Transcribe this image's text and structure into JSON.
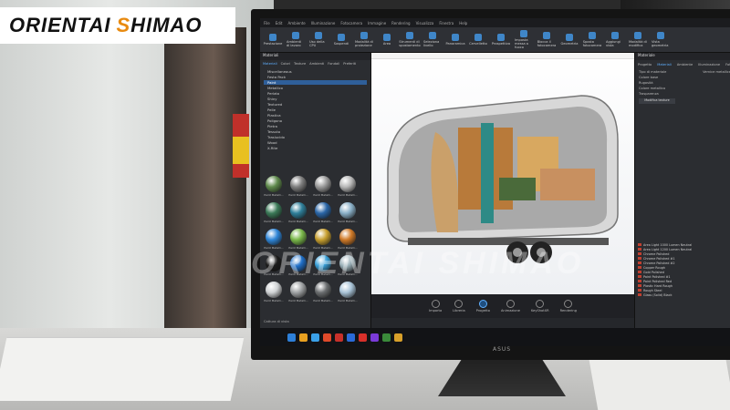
{
  "watermark": {
    "part1": "ORIENTAI",
    "part2_accent": "S",
    "part2_rest": "HIMAO",
    "overlay": "ORIENTAI SHIMAO",
    "accent_color": "#e88a10"
  },
  "app": {
    "menu": [
      "File",
      "Edit",
      "Ambiente",
      "Illuminazione",
      "Fotocamera",
      "Immagine",
      "Rendering",
      "Visualizza",
      "Finestra",
      "Help"
    ],
    "ribbon": [
      {
        "label": "Prestazione",
        "icon": "performance-icon"
      },
      {
        "label": "Ambienti di lavoro",
        "icon": "workspace-icon"
      },
      {
        "label": "Uso della CPU",
        "icon": "cpu-icon"
      },
      {
        "label": "Sospendi",
        "icon": "pause-icon"
      },
      {
        "label": "Modalità di proiezione",
        "icon": "projection-icon"
      },
      {
        "label": "Area",
        "icon": "area-icon"
      },
      {
        "label": "Strumenti di spostamento",
        "icon": "move-icon"
      },
      {
        "label": "Seleziona livello",
        "icon": "select-icon"
      },
      {
        "label": "Panoramica",
        "icon": "pan-icon"
      },
      {
        "label": "Cervelletto",
        "icon": "cam-icon"
      },
      {
        "label": "Prospettiva",
        "icon": "perspective-icon"
      },
      {
        "label": "Imposta messa a fuoco",
        "icon": "focus-icon"
      },
      {
        "label": "Blocca il fotocamera",
        "icon": "lock-camera-icon"
      },
      {
        "label": "Geometria",
        "icon": "geometry-icon"
      },
      {
        "label": "Sposta fotocamera",
        "icon": "move-camera-icon"
      },
      {
        "label": "Aggiungi vista",
        "icon": "add-view-icon"
      },
      {
        "label": "Modalità di modifica",
        "icon": "edit-mode-icon"
      },
      {
        "label": "Vista geometria",
        "icon": "geo-view-icon"
      }
    ],
    "left_panel": {
      "title": "Materiali",
      "tabs": [
        "Materiali",
        "Colori",
        "Texture",
        "Ambienti",
        "Fondali",
        "Preferiti"
      ],
      "tree": [
        "Miscellaneous",
        "Festa Pack",
        "Paint",
        "Metallico",
        "Perlato",
        "Shiny",
        "Textured",
        "Pelle",
        "Plastica",
        "Poligono",
        "Pietra",
        "Tessuto",
        "Traslucido",
        "Wood",
        "X-Rite"
      ],
      "selected": "Paint",
      "swatch_label": "Paint Metalli...",
      "swatch_colors": [
        "#5f8a4c",
        "#7f7f7f",
        "#9a9a9a",
        "#b8b8b8",
        "#3b7a58",
        "#2f7f9a",
        "#2a66a8",
        "#8ab0c8",
        "#2f86d8",
        "#7ab84a",
        "#c8a030",
        "#d07a28",
        "#1c1c1c",
        "#1f6fc8",
        "#3aa0d8",
        "#9ab0b8",
        "#cfd2d4",
        "#9fa2a4",
        "#6b6e70",
        "#a9c4d8"
      ]
    },
    "right_panel": {
      "title": "Materiale",
      "tabs": [
        "Progetto",
        "Materiali",
        "Ambiente",
        "Illuminazione",
        "Fotocamera"
      ],
      "props": [
        {
          "label": "Tipo di materiale",
          "value": "Vernice metallica"
        },
        {
          "label": "Colore base",
          "value": ""
        },
        {
          "label": "Rugosità",
          "value": ""
        },
        {
          "label": "Colore metallico",
          "value": ""
        },
        {
          "label": "Trasparenza",
          "value": ""
        }
      ],
      "button": "Modifica texture",
      "lights": [
        "Area Light 1000 Lumen Neutral",
        "Area Light 1200 Lumen Neutral",
        "Chrome Polished",
        "Chrome Polished #1",
        "Chrome Polished #2",
        "Copper Rough",
        "Gold Polished",
        "Paint Polished #1",
        "Paint Polished Red",
        "Plastic Hard Rough",
        "Rough Steel",
        "Glass (Solid) Black"
      ]
    },
    "bottom_tabs": [
      {
        "label": "Importa",
        "active": false
      },
      {
        "label": "Libreria",
        "active": false
      },
      {
        "label": "Progetto",
        "active": true
      },
      {
        "label": "Animazione",
        "active": false
      },
      {
        "label": "KeyShotXR",
        "active": false
      },
      {
        "label": "Rendering",
        "active": false
      }
    ],
    "status": "Cattura di vista"
  }
}
